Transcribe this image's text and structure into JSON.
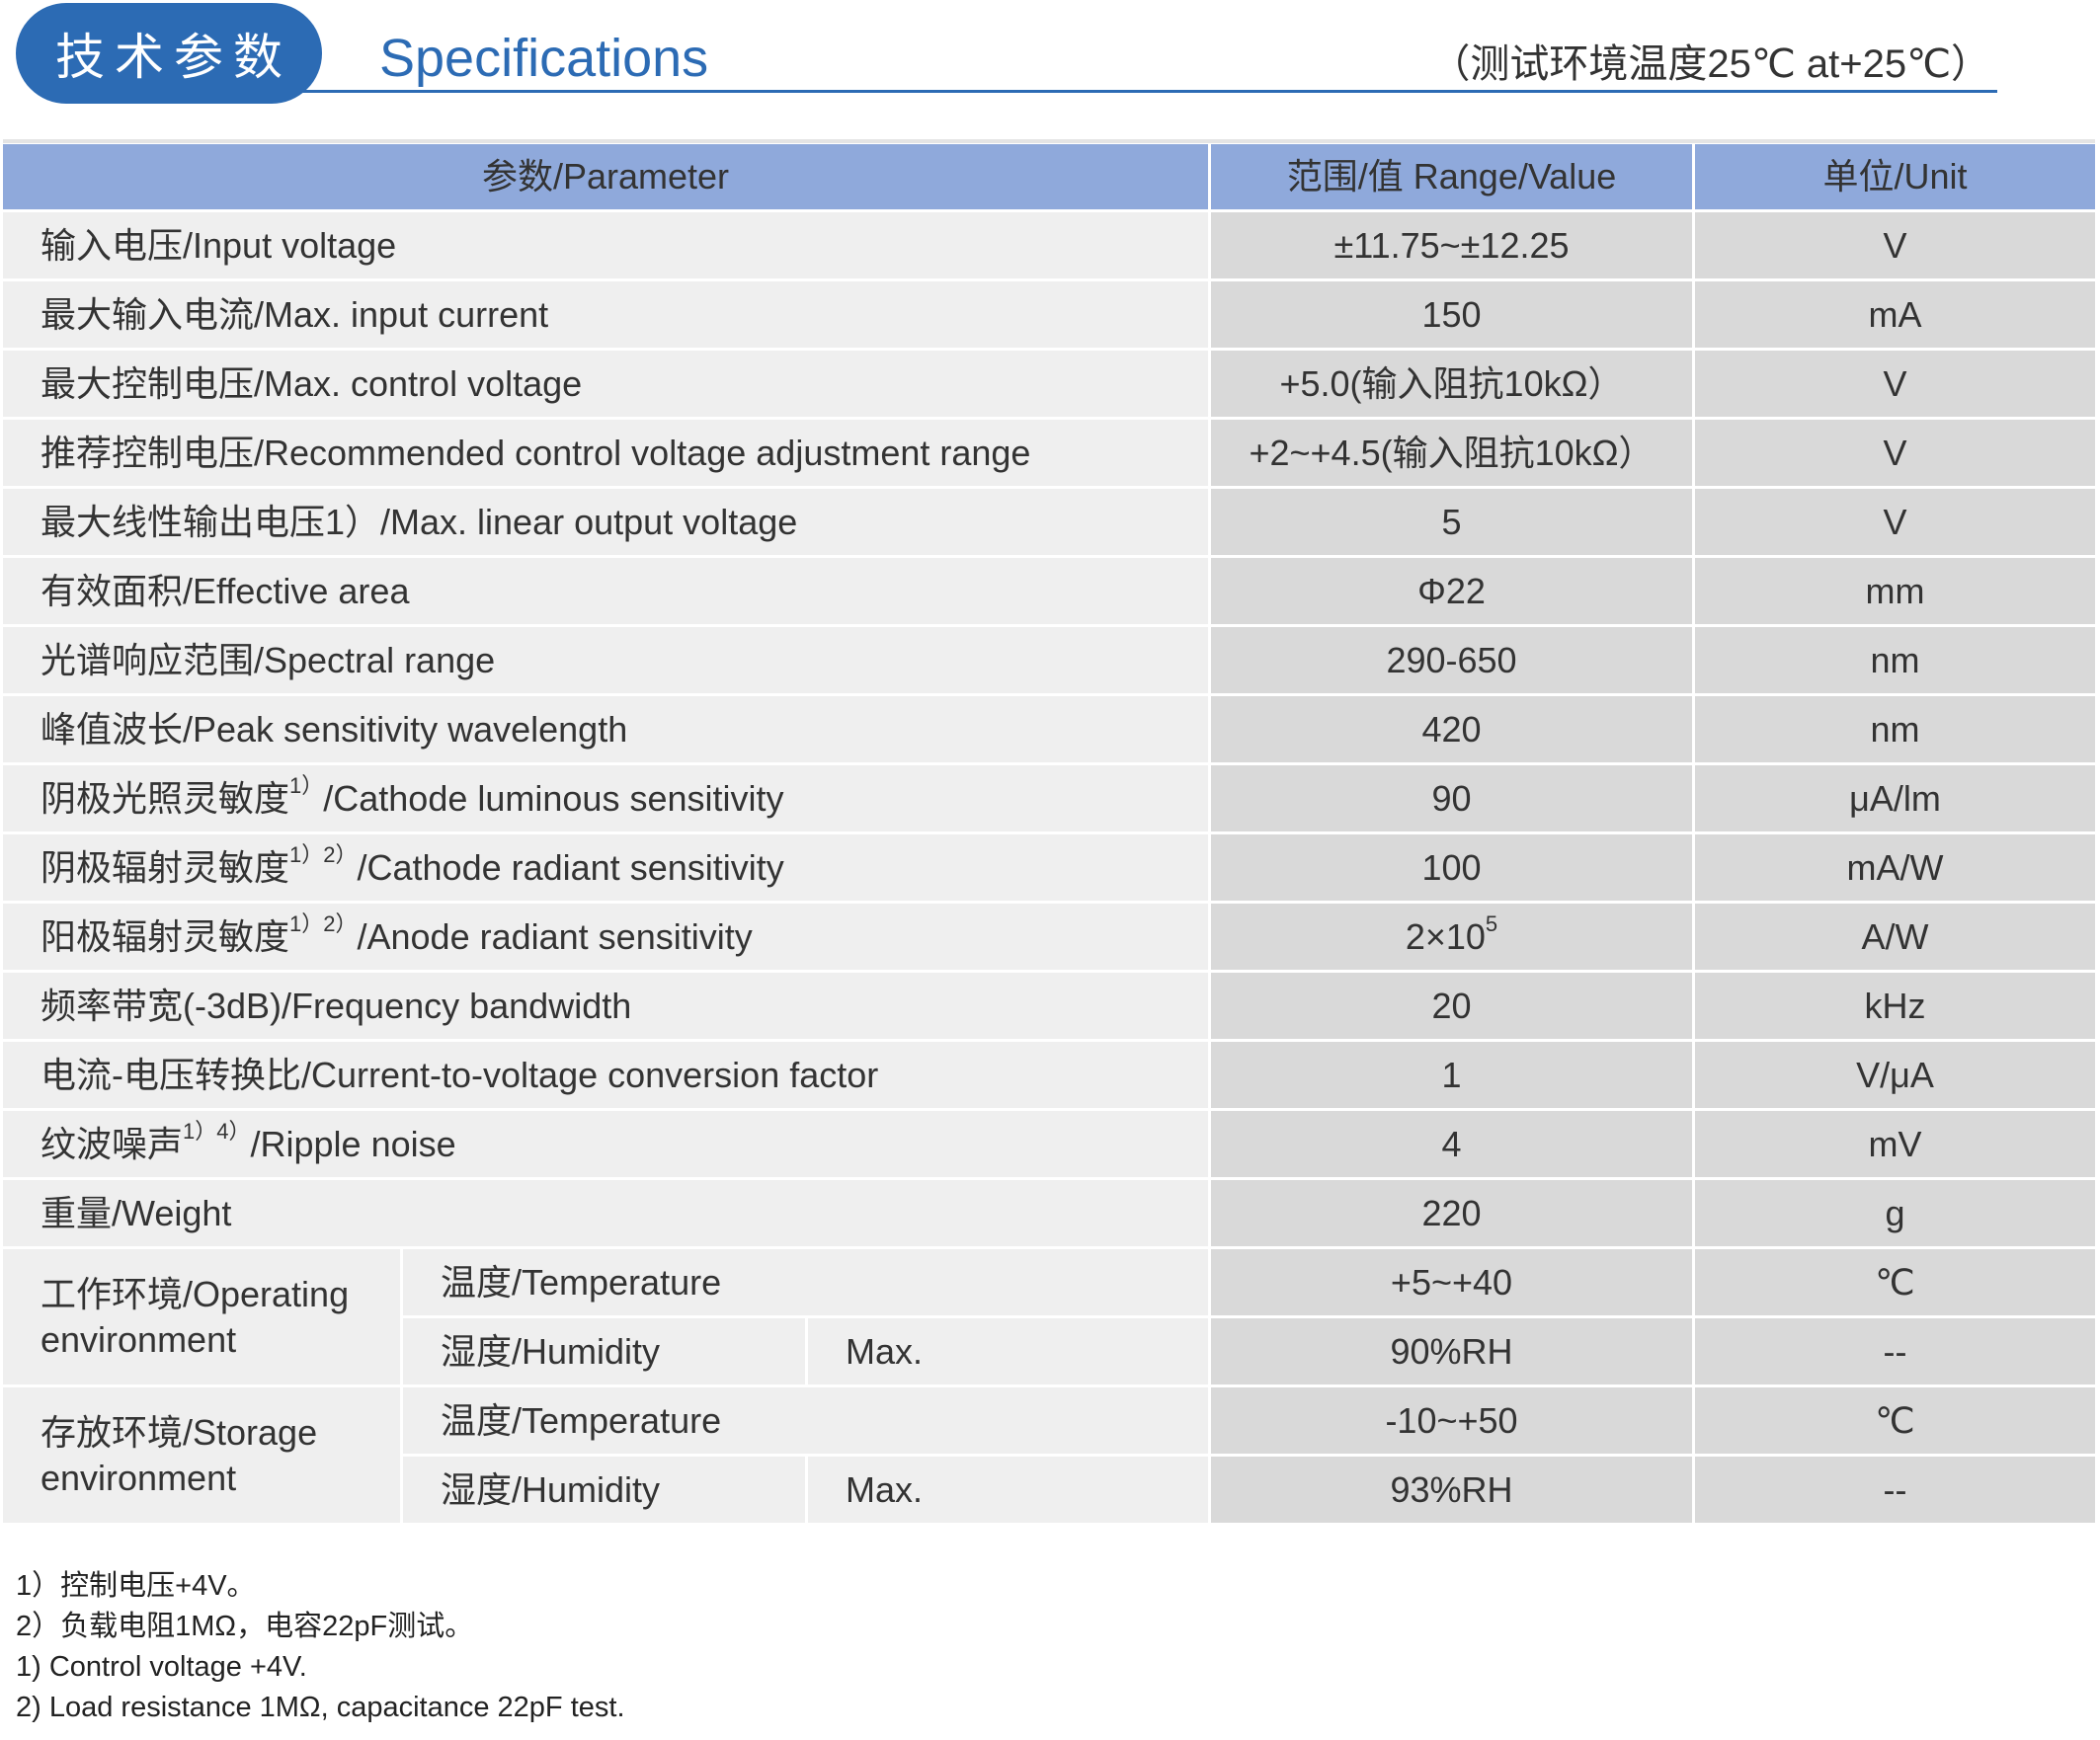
{
  "header": {
    "badge": "技术参数",
    "title": "Specifications",
    "condition": "（测试环境温度25℃ at+25℃）"
  },
  "colors": {
    "brand_blue": "#2c6bb4",
    "header_row": "#8fa9db",
    "param_cell": "#efefef",
    "value_cell": "#d9d9d9"
  },
  "table": {
    "columns": [
      "参数/Parameter",
      "范围/值 Range/Value",
      "单位/Unit"
    ],
    "rows": [
      {
        "param": "输入电压/Input voltage",
        "value": "±11.75~±12.25",
        "unit": "V"
      },
      {
        "param": "最大输入电流/Max. input current",
        "value": "150",
        "unit": "mA"
      },
      {
        "param": "最大控制电压/Max. control voltage",
        "value": "+5.0(输入阻抗10kΩ）",
        "unit": "V"
      },
      {
        "param": "推荐控制电压/Recommended control voltage adjustment range",
        "value": "+2~+4.5(输入阻抗10kΩ）",
        "unit": "V"
      },
      {
        "param": "最大线性输出电压1）/Max. linear output voltage",
        "value": "5",
        "unit": "V"
      },
      {
        "param": "有效面积/Effective area",
        "value": "Φ22",
        "unit": "mm"
      },
      {
        "param": "光谱响应范围/Spectral range",
        "value": "290-650",
        "unit": "nm"
      },
      {
        "param": "峰值波长/Peak sensitivity wavelength",
        "value": "420",
        "unit": "nm"
      },
      {
        "param": "阴极光照灵敏度",
        "param_sup": "1）",
        "param_tail": "/Cathode luminous sensitivity",
        "value": "90",
        "unit": "μA/lm"
      },
      {
        "param": "阴极辐射灵敏度",
        "param_sup": "1）2）",
        "param_tail": "/Cathode radiant sensitivity",
        "value": "100",
        "unit": "mA/W"
      },
      {
        "param": "阳极辐射灵敏度",
        "param_sup": "1）2）",
        "param_tail": "/Anode radiant sensitivity",
        "value": "2×10",
        "value_sup": "5",
        "unit": "A/W"
      },
      {
        "param": "频率带宽(-3dB)/Frequency bandwidth",
        "value": "20",
        "unit": "kHz"
      },
      {
        "param": "电流-电压转换比/Current-to-voltage conversion factor",
        "value": "1",
        "unit": "V/μA"
      },
      {
        "param": "纹波噪声",
        "param_sup": "1）4）",
        "param_tail": "/Ripple noise",
        "value": "4",
        "unit": "mV"
      },
      {
        "param": "重量/Weight",
        "value": "220",
        "unit": "g"
      }
    ],
    "operating": {
      "label": "工作环境/Operating environment",
      "temperature": {
        "label": "温度/Temperature",
        "value": "+5~+40",
        "unit": "℃"
      },
      "humidity": {
        "label": "湿度/Humidity",
        "qualifier": "Max.",
        "value": "90%RH",
        "unit": "--"
      }
    },
    "storage": {
      "label": "存放环境/Storage environment",
      "temperature": {
        "label": "温度/Temperature",
        "value": "-10~+50",
        "unit": "℃"
      },
      "humidity": {
        "label": "湿度/Humidity",
        "qualifier": "Max.",
        "value": "93%RH",
        "unit": "--"
      }
    }
  },
  "footnotes": [
    "1）控制电压+4V。",
    "2）负载电阻1MΩ，电容22pF测试。",
    "1) Control voltage +4V.",
    "2) Load resistance 1MΩ, capacitance 22pF test."
  ]
}
